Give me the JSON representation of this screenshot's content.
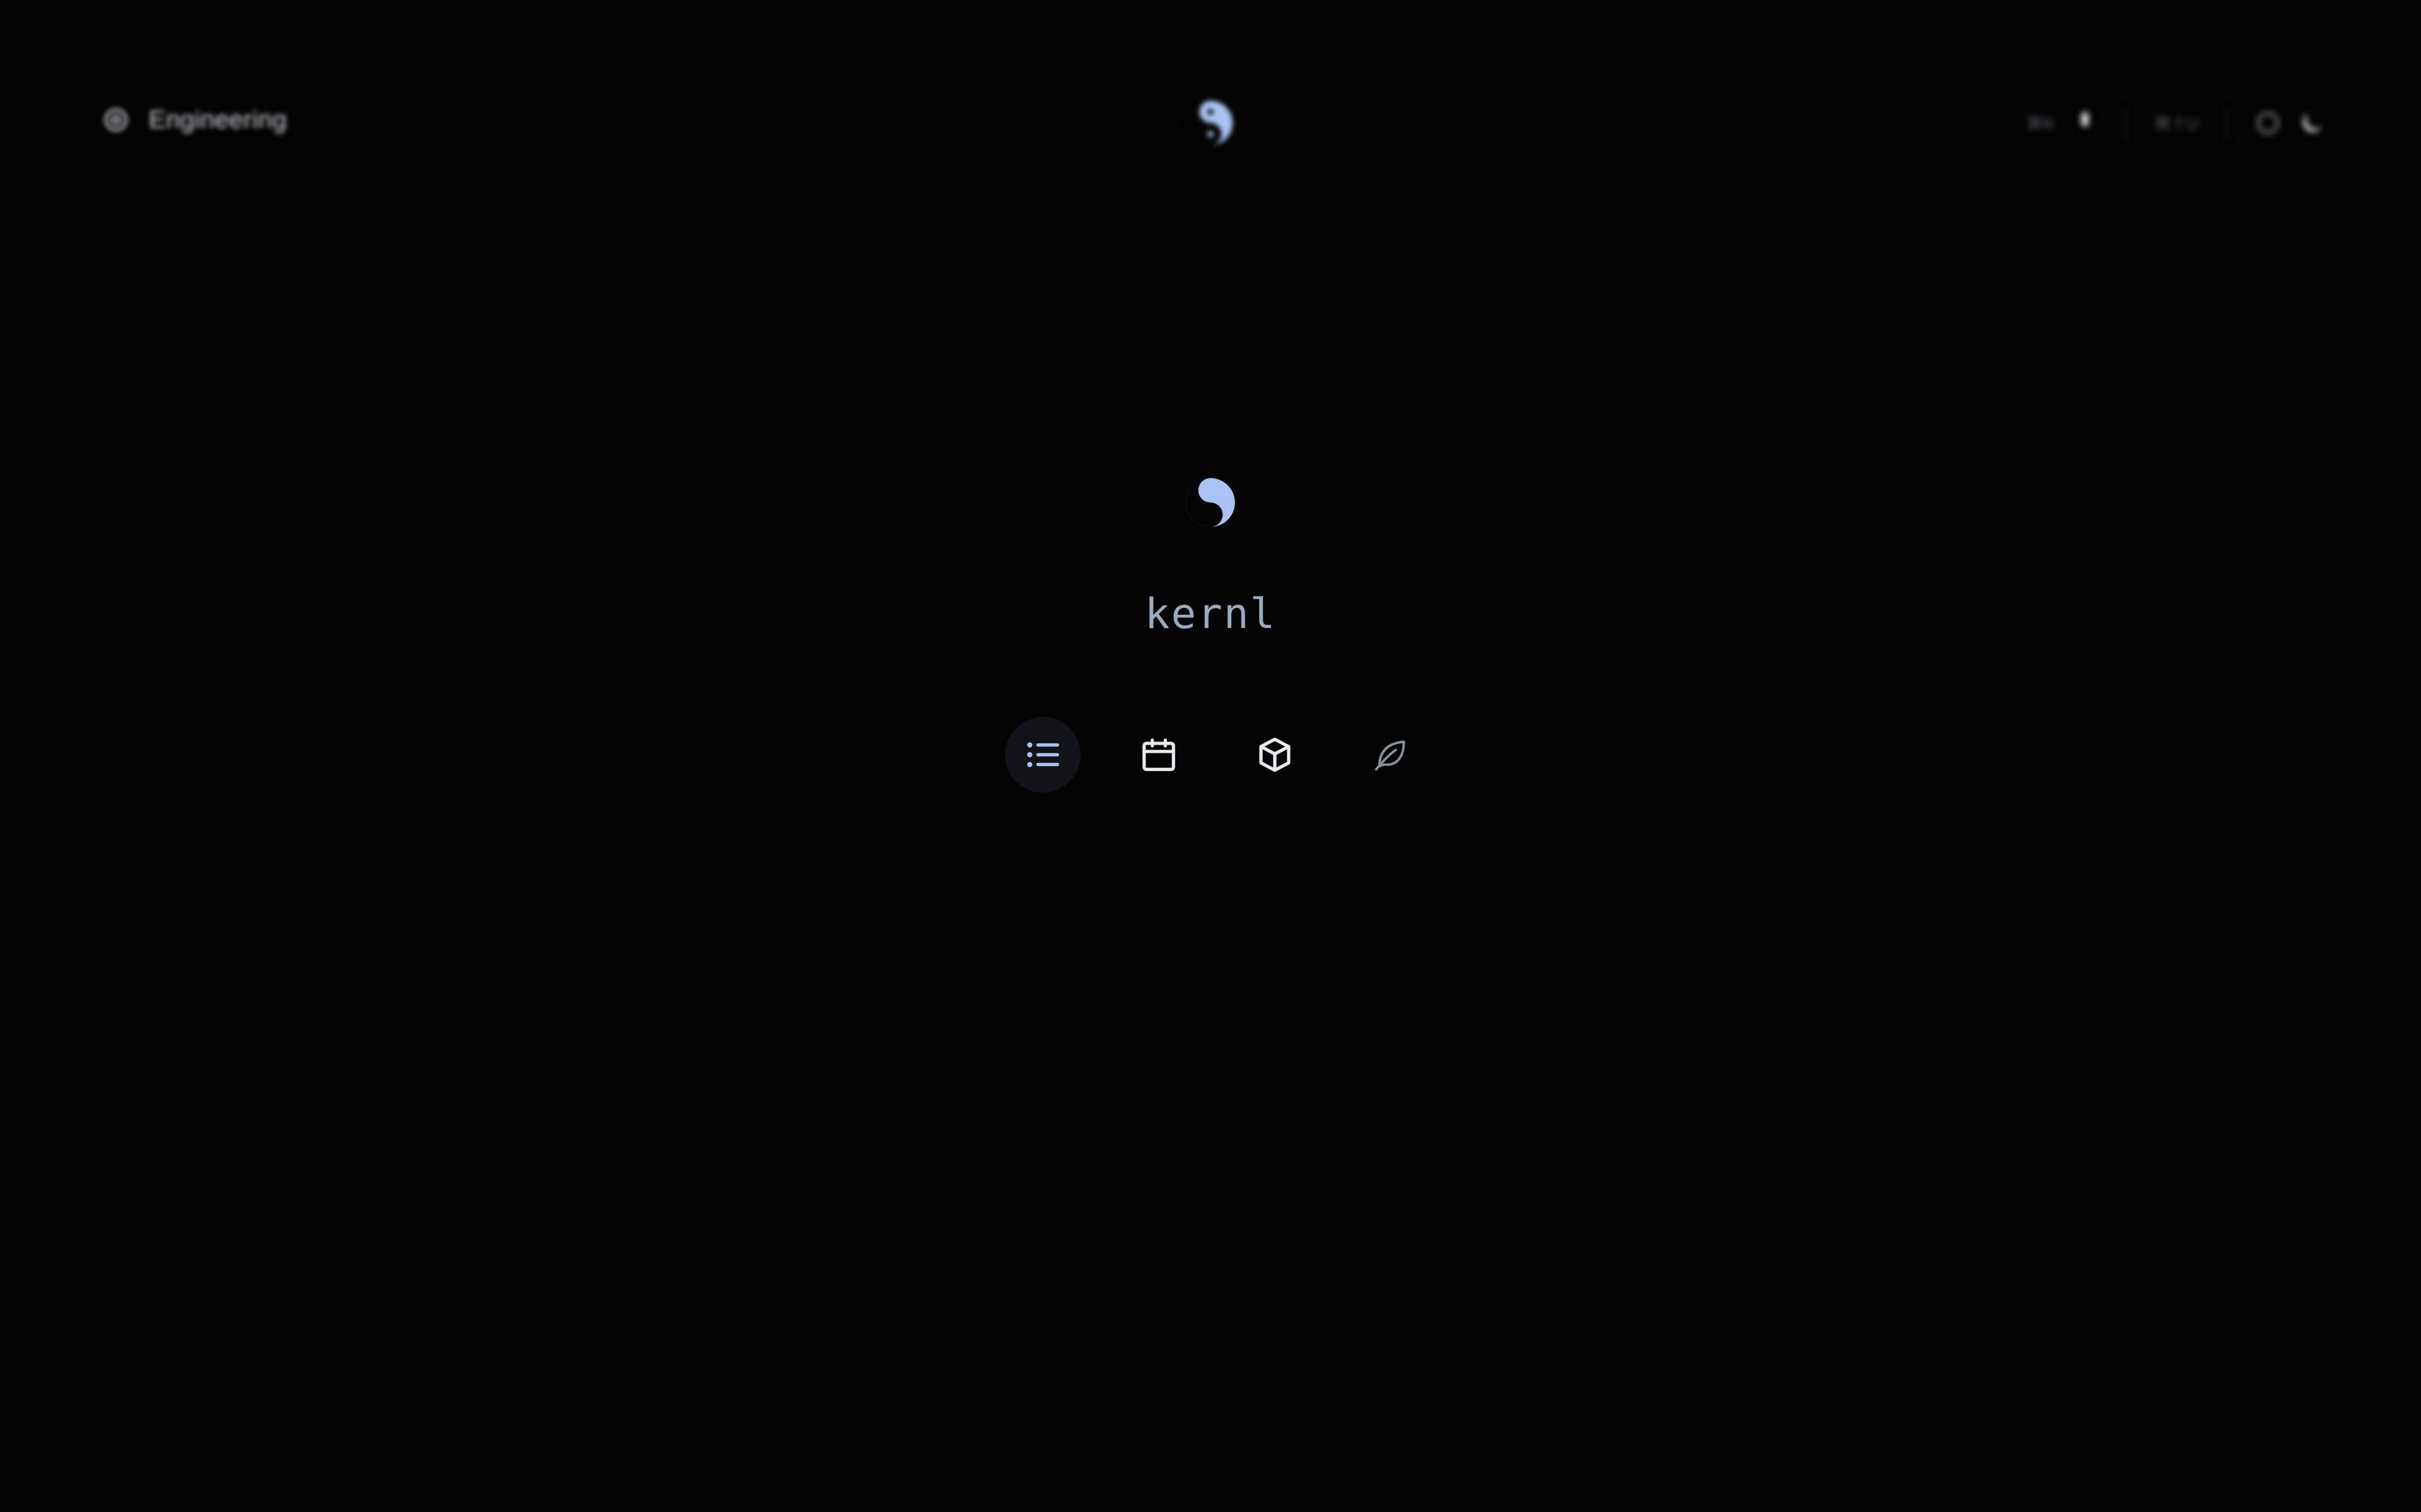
{
  "topbar": {
    "workspace_label": "Engineering",
    "shortcut_search": "⌘K",
    "shortcut_new": "⌘⇧U"
  },
  "main": {
    "app_name": "kernl"
  },
  "nav": {
    "items": [
      {
        "name": "list",
        "icon": "list-icon",
        "active": true
      },
      {
        "name": "calendar",
        "icon": "calendar-icon",
        "active": false
      },
      {
        "name": "box",
        "icon": "box-icon",
        "active": false
      },
      {
        "name": "leaf",
        "icon": "leaf-icon",
        "active": false
      }
    ]
  },
  "colors": {
    "background": "#030303",
    "accent": "#a9c2f2",
    "active_pill": "#111318",
    "app_name": "#9aabbf"
  }
}
